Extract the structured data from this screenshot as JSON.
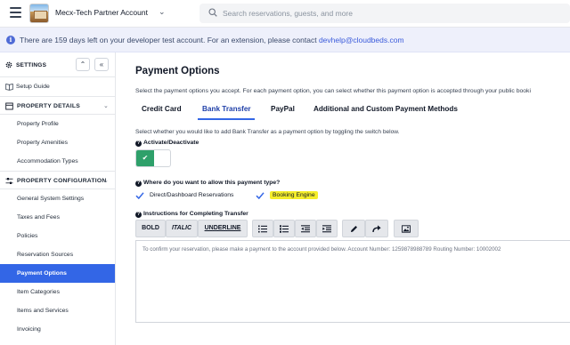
{
  "header": {
    "account_name": "Mecx-Tech Partner Account",
    "search_placeholder": "Search reservations, guests, and more"
  },
  "banner": {
    "text": "There are 159 days left on your developer test account. For an extension, please contact ",
    "link": "devhelp@cloudbeds.com"
  },
  "sidebar": {
    "settings_label": "SETTINGS",
    "up_glyph": "«",
    "items": [
      {
        "label": "Setup Guide"
      },
      {
        "label": "PROPERTY DETAILS"
      },
      {
        "label": "Property Profile"
      },
      {
        "label": "Property Amenities"
      },
      {
        "label": "Accommodation Types"
      },
      {
        "label": "PROPERTY CONFIGURATION"
      },
      {
        "label": "General System Settings"
      },
      {
        "label": "Taxes and Fees"
      },
      {
        "label": "Policies"
      },
      {
        "label": "Reservation Sources"
      },
      {
        "label": "Payment Options"
      },
      {
        "label": "Item Categories"
      },
      {
        "label": "Items and Services"
      },
      {
        "label": "Invoicing"
      }
    ],
    "active_item": "Payment Options"
  },
  "main": {
    "title": "Payment Options",
    "description": "Select the payment options you accept. For each payment option, you can select whether this payment option is accepted through your public booki",
    "tabs": [
      {
        "label": "Credit Card"
      },
      {
        "label": "Bank Transfer"
      },
      {
        "label": "PayPal"
      },
      {
        "label": "Additional and Custom Payment Methods"
      }
    ],
    "active_tab": "Bank Transfer",
    "select_description": "Select whether you would like to add Bank Transfer as a payment option by toggling the switch below.",
    "activate_label": "Activate/Deactivate",
    "activate_state": true,
    "where_label": "Where do you want to allow this payment type?",
    "options": [
      {
        "label": "Direct/Dashboard Reservations",
        "checked": true
      },
      {
        "label": "Booking Engine",
        "checked": true
      }
    ],
    "instructions_label": "Instructions for Completing Transfer",
    "toolbar": {
      "bold": "BOLD",
      "italic": "ITALIC",
      "underline": "UNDERLINE"
    },
    "instructions_text": "To confirm your reservation, please make a payment to the account provided below. Account Number: 1259878988789 Routing Number: 10002002"
  },
  "colors": {
    "accent": "#3366e6",
    "toggle_on": "#2ea06a",
    "highlight": "#f5ee2a",
    "banner_bg": "#eef0fb"
  }
}
